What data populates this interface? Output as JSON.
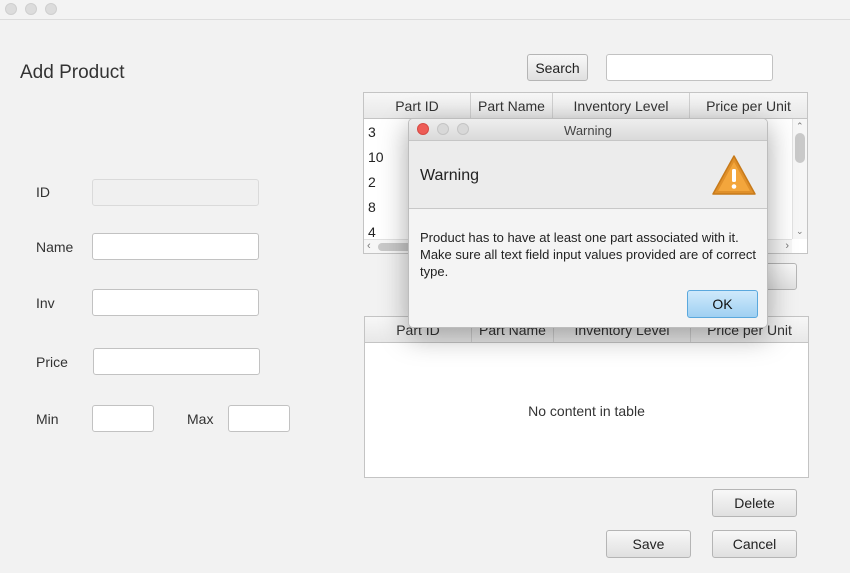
{
  "form": {
    "title": "Add Product",
    "id_label": "ID",
    "id_value": "",
    "name_label": "Name",
    "name_value": "",
    "inv_label": "Inv",
    "inv_value": "",
    "price_label": "Price",
    "price_value": "",
    "min_label": "Min",
    "min_value": "",
    "max_label": "Max",
    "max_value": ""
  },
  "search": {
    "button_label": "Search",
    "query": ""
  },
  "parts_table": {
    "columns": [
      "Part ID",
      "Part Name",
      "Inventory Level",
      "Price per Unit"
    ],
    "rows": [
      {
        "part_id": "3"
      },
      {
        "part_id": "10"
      },
      {
        "part_id": "2"
      },
      {
        "part_id": "8"
      },
      {
        "part_id": "4"
      }
    ]
  },
  "associated_table": {
    "columns": [
      "Part ID",
      "Part Name",
      "Inventory Level",
      "Price per Unit"
    ],
    "empty_text": "No content in table"
  },
  "buttons": {
    "delete": "Delete",
    "save": "Save",
    "cancel": "Cancel"
  },
  "dialog": {
    "window_title": "Warning",
    "heading": "Warning",
    "message": "Product has to have at least one part associated with it. Make sure all text field input values provided are of correct type.",
    "ok_label": "OK",
    "icon": "warning-triangle-icon",
    "icon_color": "#e0902a",
    "close_color": "#ee5c56"
  }
}
